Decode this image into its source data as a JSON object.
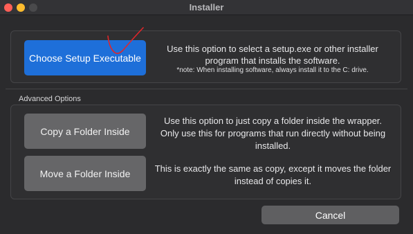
{
  "window": {
    "title": "Installer",
    "close_color": "#ff5f57",
    "minimize_color": "#febc2e",
    "maximize_color": "#4a4a4c"
  },
  "setup": {
    "button_label": "Choose Setup Executable",
    "description": "Use this option to select a setup.exe or other installer program that installs the software.",
    "note": "*note: When installing software, always install it to the C: drive.",
    "accent": "#1e6fd9"
  },
  "advanced": {
    "section_label": "Advanced Options",
    "copy_button_label": "Copy a Folder Inside",
    "copy_description": "Use this option to just copy a folder inside the wrapper. Only use this for programs that run directly without being installed.",
    "move_button_label": "Move a Folder Inside",
    "move_description": "This is exactly the same as copy, except it moves the folder instead of copies it."
  },
  "footer": {
    "cancel_label": "Cancel"
  },
  "annotation": {
    "stroke_color": "#e0262a"
  }
}
